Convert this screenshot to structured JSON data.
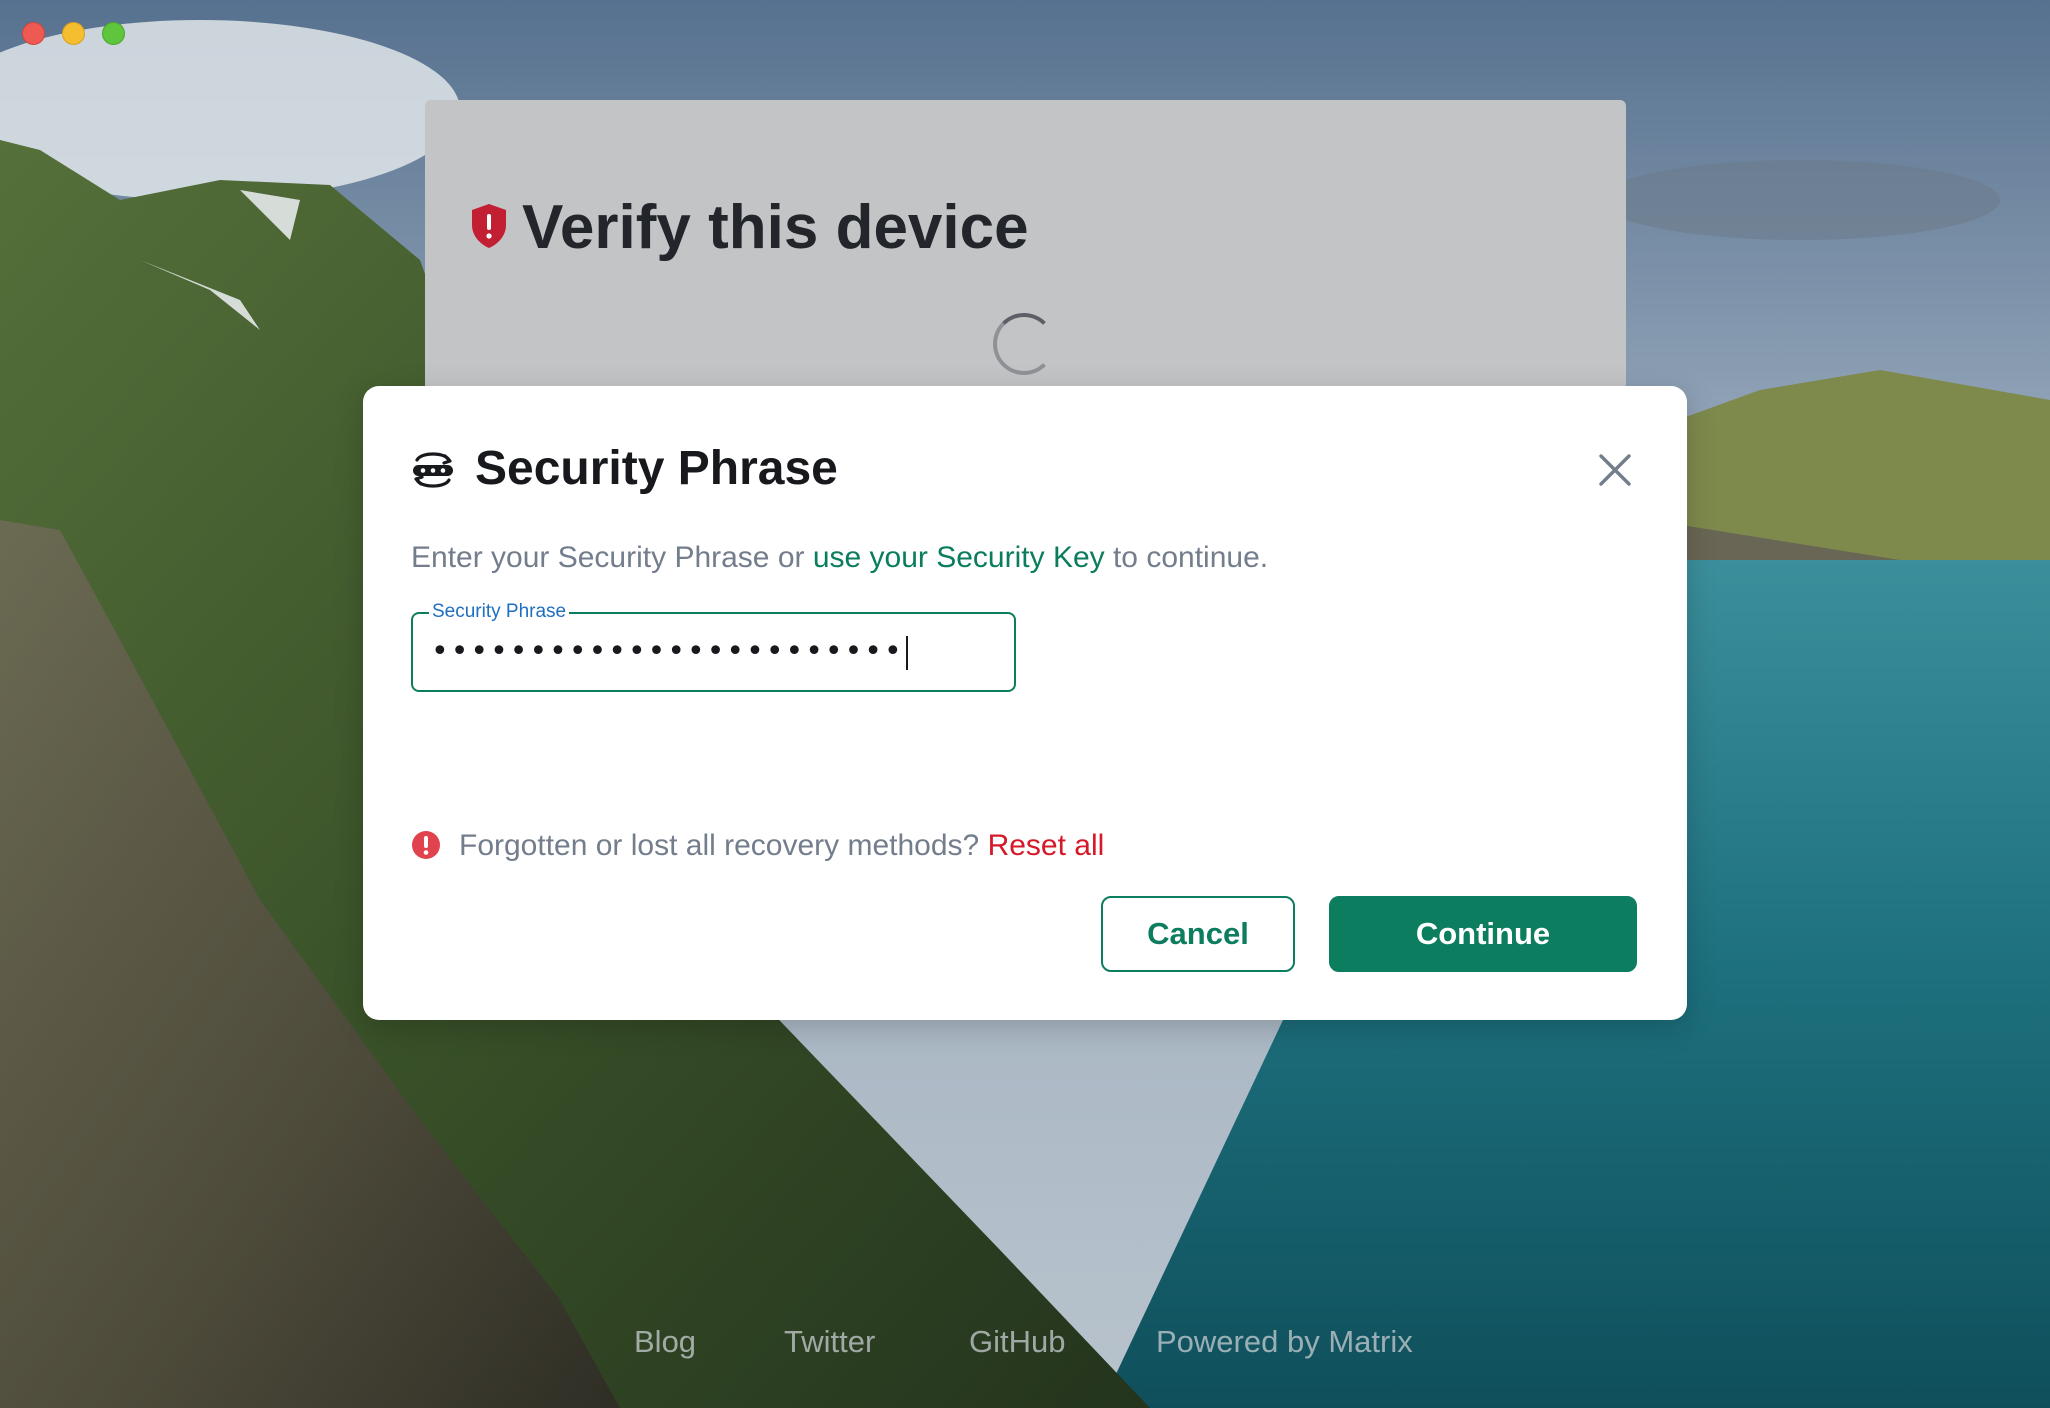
{
  "background_page": {
    "title": "Verify this device"
  },
  "dialog": {
    "title": "Security Phrase",
    "description_prefix": "Enter your Security Phrase or ",
    "description_link": "use your Security Key",
    "description_suffix": " to continue.",
    "field": {
      "label": "Security Phrase",
      "value": "••••••••••••••••••••••••"
    },
    "warning_text": "Forgotten or lost all recovery methods? ",
    "reset_link": "Reset all",
    "cancel_label": "Cancel",
    "continue_label": "Continue"
  },
  "footer": {
    "links": [
      "Blog",
      "Twitter",
      "GitHub",
      "Powered by Matrix"
    ]
  },
  "colors": {
    "accent": "#0d7d5f",
    "danger": "#d51928",
    "link_blue": "#1f6fc0"
  },
  "icons": {
    "window_controls": [
      "close-dot",
      "minimize-dot",
      "zoom-dot"
    ],
    "back_panel_icon": "shield-alert-icon",
    "dialog_icon": "security-phrase-icon",
    "close_icon": "close-icon",
    "warning_icon": "error-circle-icon"
  }
}
